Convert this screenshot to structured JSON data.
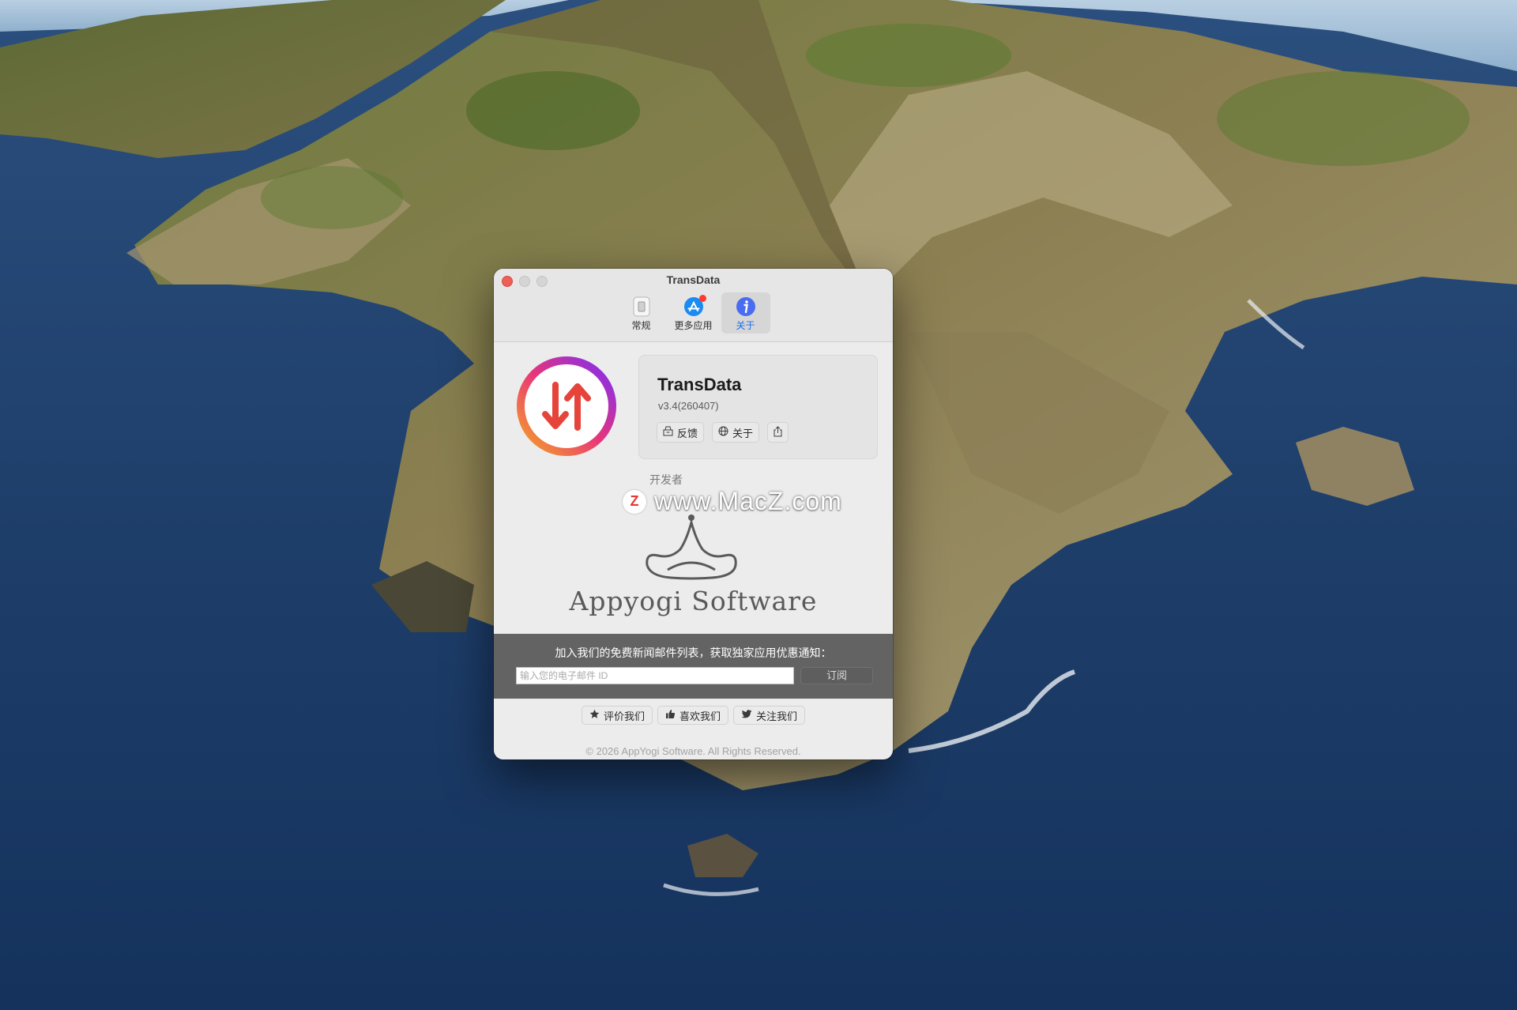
{
  "window": {
    "title": "TransData"
  },
  "toolbar": {
    "items": [
      {
        "label": "常规",
        "icon": "phone-icon"
      },
      {
        "label": "更多应用",
        "icon": "app-store-icon",
        "badge": true
      },
      {
        "label": "关于",
        "icon": "info-icon",
        "active": true
      }
    ]
  },
  "about": {
    "app_name": "TransData",
    "version": "v3.4(260407)",
    "buttons": {
      "feedback": "反馈",
      "about": "关于"
    },
    "developer_label": "开发者",
    "developer_name": "Appyogi Software"
  },
  "watermark": {
    "text": "www.MacZ.com",
    "badge": "Z"
  },
  "newsletter": {
    "text": "加入我们的免费新闻邮件列表，获取独家应用优惠通知：",
    "email_placeholder": "输入您的电子邮件 ID",
    "subscribe_label": "订阅"
  },
  "social": {
    "rate": "评价我们",
    "like": "喜欢我们",
    "follow": "关注我们"
  },
  "footer": {
    "copyright": "© 2026 AppYogi Software. All Rights Reserved."
  },
  "colors": {
    "accent": "#1d6ee8",
    "close": "#ee5f57",
    "logo_gradient": [
      "#f5a623",
      "#e8347a",
      "#7b2ff7"
    ],
    "arrow": "#e6443a"
  }
}
